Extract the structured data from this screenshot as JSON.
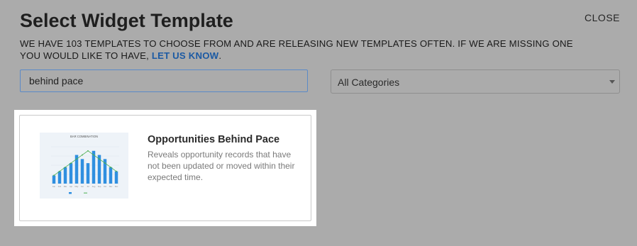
{
  "modal": {
    "title": "Select Widget Template",
    "close_label": "CLOSE",
    "intro_text": "WE HAVE 103 TEMPLATES TO CHOOSE FROM AND ARE RELEASING NEW TEMPLATES OFTEN. IF WE ARE MISSING ONE YOU WOULD LIKE TO HAVE, ",
    "intro_link": "LET US KNOW",
    "intro_end": "."
  },
  "search": {
    "value": "behind pace"
  },
  "category_filter": {
    "selected": "All Categories"
  },
  "results": [
    {
      "title": "Opportunities Behind Pace",
      "description": "Reveals opportunity records that have not been updated or moved within their expected time.",
      "thumbnail": {
        "chart_data": {
          "type": "bar",
          "title": "BAR COMBINATION",
          "categories": [
            "Jan",
            "Feb",
            "Mar",
            "Apr",
            "May",
            "Jun",
            "Jul",
            "Aug",
            "Sep",
            "Oct",
            "Nov",
            "Dec"
          ],
          "series": [
            {
              "name": "",
              "type": "bar",
              "values": [
                2,
                3,
                4,
                5,
                7,
                6,
                5,
                8,
                7,
                6,
                4,
                3
              ]
            },
            {
              "name": "",
              "type": "line",
              "values": [
                2,
                3,
                4,
                5,
                6,
                7,
                8,
                7,
                6,
                5,
                4,
                3
              ]
            }
          ],
          "colors": {
            "bar": "#2f8fe0",
            "line": "#4caf50"
          }
        }
      }
    }
  ],
  "colors": {
    "overlay": "#ababab",
    "link": "#1c5aa3",
    "search_border": "#5b8ac7"
  }
}
